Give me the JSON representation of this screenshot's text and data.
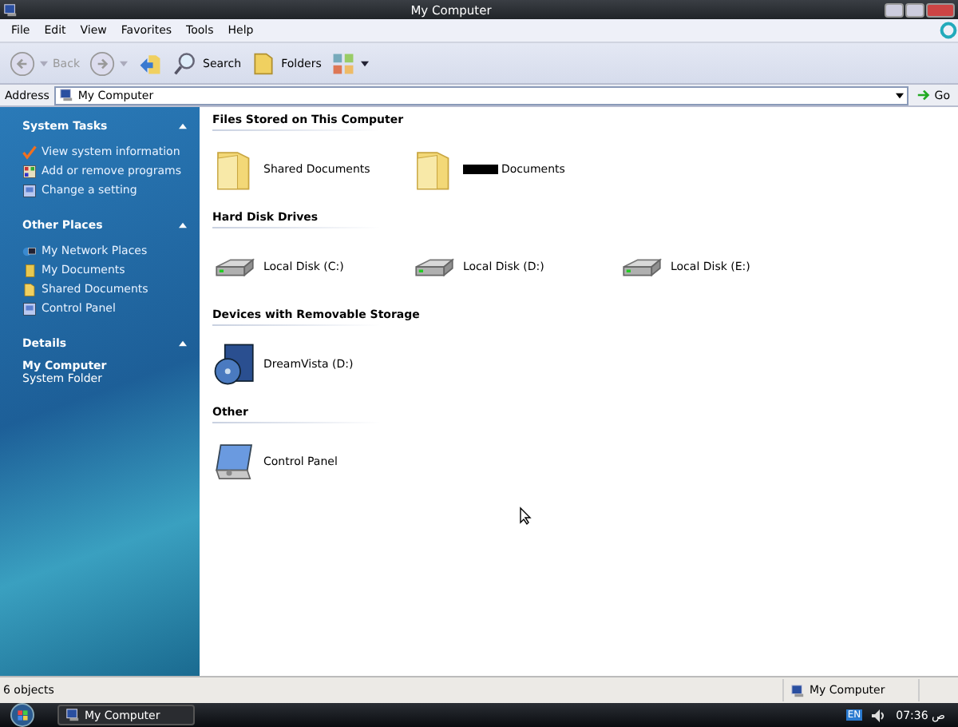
{
  "window": {
    "title": "My Computer"
  },
  "menu": [
    "File",
    "Edit",
    "View",
    "Favorites",
    "Tools",
    "Help"
  ],
  "toolbar": [
    {
      "kind": "back",
      "label": "Back",
      "disabled": true
    },
    {
      "kind": "forward",
      "disabled": true
    },
    {
      "kind": "up"
    },
    {
      "kind": "search",
      "label": "Search"
    },
    {
      "kind": "folders",
      "label": "Folders"
    },
    {
      "kind": "views"
    }
  ],
  "address": {
    "label": "Address",
    "value": "My Computer",
    "go": "Go"
  },
  "sidebar": [
    {
      "title": "System Tasks",
      "kind": "tasks",
      "items": [
        {
          "label": "View system information",
          "kind": "check"
        },
        {
          "label": "Add or remove programs",
          "kind": "programs"
        },
        {
          "label": "Change a setting",
          "kind": "panel"
        }
      ]
    },
    {
      "title": "Other Places",
      "kind": "tasks",
      "items": [
        {
          "label": "My Network Places",
          "kind": "network"
        },
        {
          "label": "My Documents",
          "kind": "docs"
        },
        {
          "label": "Shared Documents",
          "kind": "folder"
        },
        {
          "label": "Control Panel",
          "kind": "panel"
        }
      ]
    },
    {
      "title": "Details",
      "kind": "details",
      "name": "My Computer",
      "type": "System Folder"
    }
  ],
  "sections": [
    {
      "title": "Files Stored on This Computer",
      "items": [
        {
          "kind": "folder",
          "label": "Shared Documents",
          "redacted": false
        },
        {
          "kind": "folder",
          "label": "Documents",
          "redacted": true
        }
      ]
    },
    {
      "title": "Hard Disk Drives",
      "items": [
        {
          "kind": "drive",
          "label": "Local Disk (C:)",
          "redacted": false
        },
        {
          "kind": "drive",
          "label": "Local Disk (D:)",
          "redacted": false
        },
        {
          "kind": "drive",
          "label": "Local Disk (E:)",
          "redacted": false
        }
      ]
    },
    {
      "title": "Devices with Removable Storage",
      "items": [
        {
          "kind": "cd",
          "label": "DreamVista (D:)",
          "redacted": false
        }
      ]
    },
    {
      "title": "Other",
      "items": [
        {
          "kind": "control",
          "label": "Control Panel",
          "redacted": false
        }
      ]
    }
  ],
  "status_bar": {
    "count": "6 objects",
    "location": "My Computer"
  },
  "taskbar": {
    "window": "My Computer",
    "language": "EN",
    "clock": "07:36 ص"
  }
}
